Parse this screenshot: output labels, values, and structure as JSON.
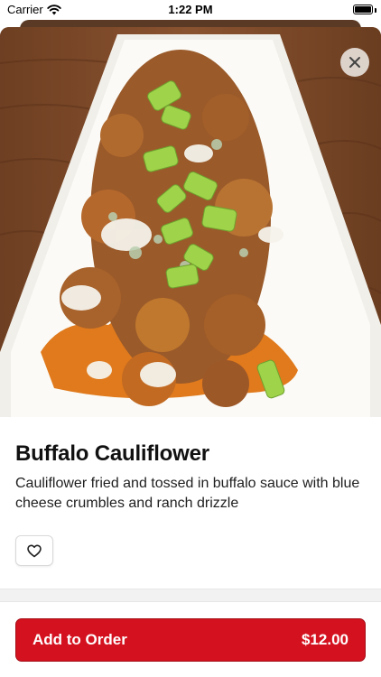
{
  "status_bar": {
    "carrier": "Carrier",
    "time": "1:22 PM"
  },
  "item": {
    "title": "Buffalo Cauliflower",
    "description": "Cauliflower fried and tossed in buffalo sauce with blue cheese crumbles and ranch drizzle",
    "image_icon": "food-photo"
  },
  "actions": {
    "close_icon": "close-icon",
    "favorite_icon": "heart-icon",
    "add_to_order_label": "Add to Order",
    "price": "$12.00"
  },
  "colors": {
    "accent": "#d4121f"
  }
}
